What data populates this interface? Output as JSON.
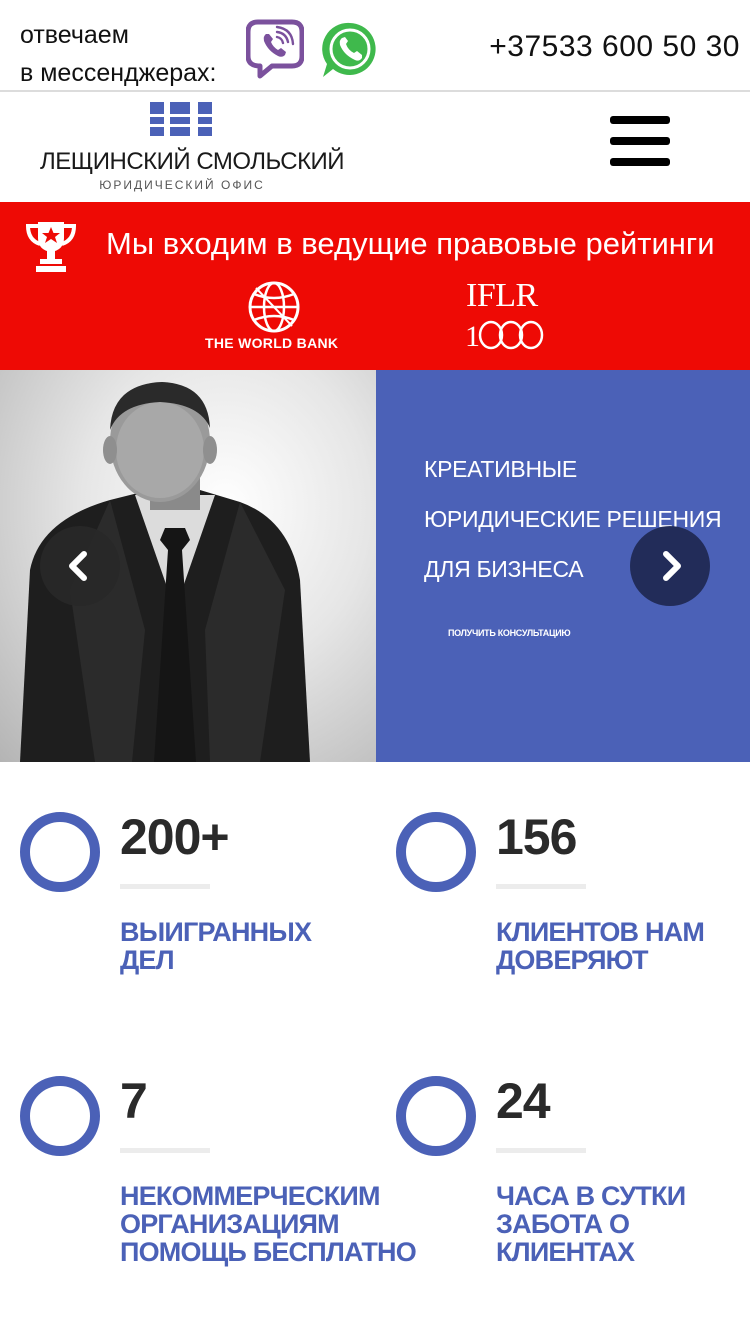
{
  "topbar": {
    "messenger_line1": "отвечаем",
    "messenger_line2": "в мессенджерах:",
    "phone": "+37533 600 50 30"
  },
  "logo": {
    "name": "ЛЕЩИНСКИЙ СМОЛЬСКИЙ",
    "subtitle": "ЮРИДИЧЕСКИЙ ОФИС"
  },
  "ratings": {
    "title": "Мы входим в ведущие правовые рейтинги",
    "world_bank": "THE WORLD BANK",
    "iflr_top": "IFLR",
    "iflr_bottom": "1000"
  },
  "hero": {
    "line1": "КРЕАТИВНЫЕ",
    "line2": "ЮРИДИЧЕСКИЕ РЕШЕНИЯ",
    "line3": "ДЛЯ БИЗНЕСА",
    "cta": "ПОЛУЧИТЬ КОНСУЛЬТАЦИЮ"
  },
  "stats": [
    {
      "number": "200+",
      "label": "ВЫИГРАННЫХ ДЕЛ"
    },
    {
      "number": "156",
      "label": "КЛИЕНТОВ НАМ ДОВЕРЯЮТ"
    },
    {
      "number": "7",
      "label": "НЕКОММЕРЧЕСКИМ ОРГАНИЗАЦИЯМ ПОМОЩЬ БЕСПЛАТНО"
    },
    {
      "number": "24",
      "label": "ЧАСА В СУТКИ ЗАБОТА О КЛИЕНТАХ"
    }
  ],
  "colors": {
    "brand_blue": "#4b61b7",
    "banner_red": "#ee0a05",
    "viber": "#7b519d",
    "whatsapp": "#3fb94c"
  },
  "icons": [
    "viber-icon",
    "whatsapp-icon",
    "menu-icon",
    "trophy-icon",
    "world-bank-globe-icon",
    "chevron-left-icon",
    "chevron-right-icon"
  ]
}
